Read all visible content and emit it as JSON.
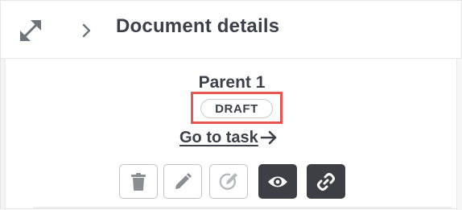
{
  "header": {
    "title": "Document details",
    "expand_icon": "expand-arrows-icon",
    "chevron_icon": "chevron-right-icon"
  },
  "document": {
    "parent_name": "Parent 1",
    "status_badge": "DRAFT",
    "go_to_task_label": "Go to task",
    "go_to_task_icon": "arrow-right-icon"
  },
  "actions": [
    {
      "name": "delete",
      "icon": "trash-icon",
      "style": "outlined"
    },
    {
      "name": "edit",
      "icon": "pencil-icon",
      "style": "outlined"
    },
    {
      "name": "sign",
      "icon": "signature-icon",
      "style": "outlined"
    },
    {
      "name": "view",
      "icon": "eye-icon",
      "style": "filled"
    },
    {
      "name": "link",
      "icon": "link-icon",
      "style": "filled"
    }
  ],
  "colors": {
    "highlight": "#e8574f",
    "dark_button": "#3c3f44",
    "text": "#3b4049"
  }
}
